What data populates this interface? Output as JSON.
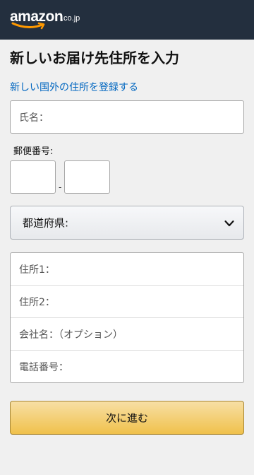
{
  "colors": {
    "header_bg": "#232f3e",
    "link": "#0066c0",
    "button": "#f0c14b",
    "logo_smile": "#ff9900"
  },
  "header": {
    "logo_text": "amazon",
    "logo_tld": ".co.jp"
  },
  "page": {
    "title": "新しいお届け先住所を入力",
    "intl_link": "新しい国外の住所を登録する"
  },
  "form": {
    "name_placeholder": "氏名：",
    "postal_label": "郵便番号:",
    "postal_separator": "-",
    "prefecture_label": "都道府県:",
    "address1_placeholder": "住所1：",
    "address2_placeholder": "住所2：",
    "company_placeholder": "会社名：（オプション）",
    "phone_placeholder": "電話番号：",
    "submit_label": "次に進む"
  },
  "icons": {
    "dropdown": "chevron-down-icon",
    "logo": "amazon-logo"
  }
}
